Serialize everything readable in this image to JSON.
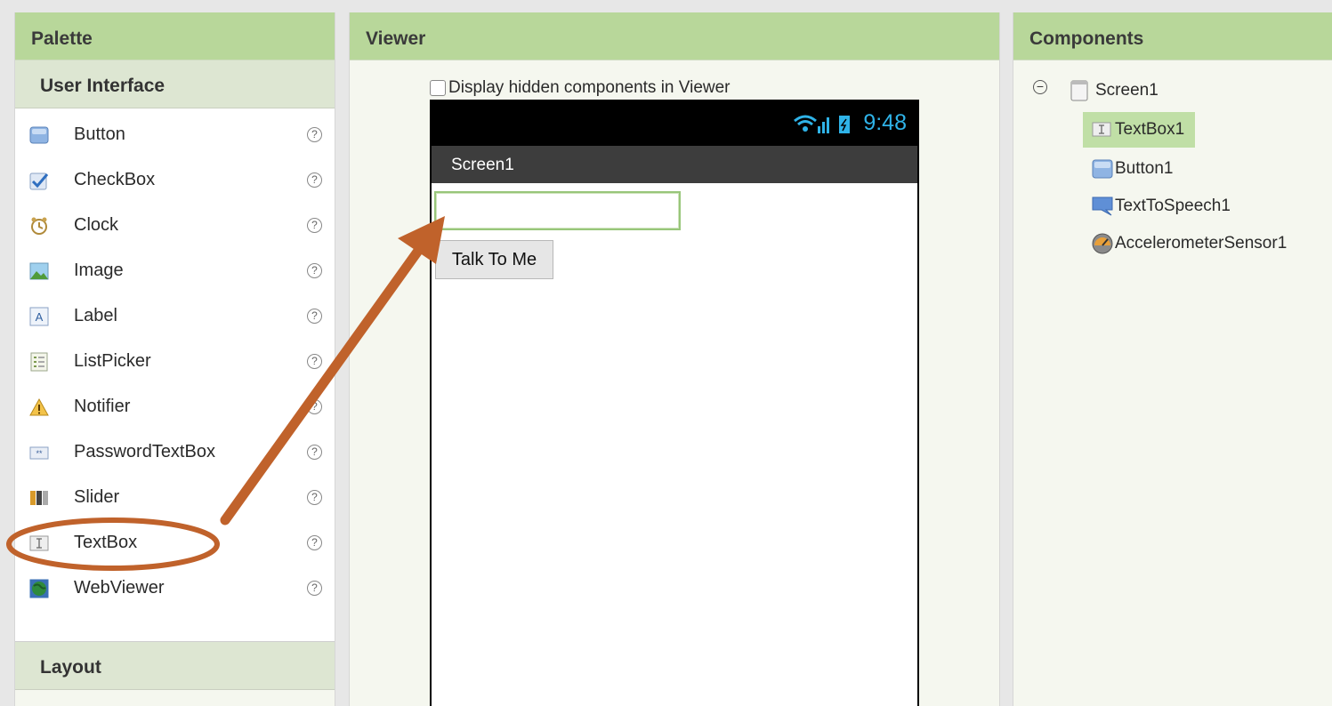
{
  "palette": {
    "title": "Palette",
    "section_ui": "User Interface",
    "items": [
      {
        "label": "Button",
        "icon": "button-icon"
      },
      {
        "label": "CheckBox",
        "icon": "checkbox-icon"
      },
      {
        "label": "Clock",
        "icon": "clock-icon"
      },
      {
        "label": "Image",
        "icon": "image-icon"
      },
      {
        "label": "Label",
        "icon": "label-icon"
      },
      {
        "label": "ListPicker",
        "icon": "listpicker-icon"
      },
      {
        "label": "Notifier",
        "icon": "notifier-icon"
      },
      {
        "label": "PasswordTextBox",
        "icon": "password-icon"
      },
      {
        "label": "Slider",
        "icon": "slider-icon"
      },
      {
        "label": "TextBox",
        "icon": "textbox-icon"
      },
      {
        "label": "WebViewer",
        "icon": "webviewer-icon"
      }
    ],
    "help_glyph": "?",
    "section_layout": "Layout"
  },
  "viewer": {
    "title": "Viewer",
    "hidden_toggle_label": "Display hidden components in Viewer",
    "status_time": "9:48",
    "screen_title": "Screen1",
    "button_label": "Talk To Me"
  },
  "components": {
    "title": "Components",
    "collapse_glyph": "−",
    "tree": [
      {
        "label": "Screen1",
        "icon": "screen-icon"
      },
      {
        "label": "TextBox1",
        "icon": "textbox-icon",
        "selected": true
      },
      {
        "label": "Button1",
        "icon": "button-icon"
      },
      {
        "label": "TextToSpeech1",
        "icon": "speech-icon"
      },
      {
        "label": "AccelerometerSensor1",
        "icon": "accelerometer-icon"
      }
    ]
  },
  "colors": {
    "header": "#b8d79a",
    "annotation": "#c0622b",
    "status_time": "#2fb3e8",
    "selected": "#c0dfa6"
  }
}
